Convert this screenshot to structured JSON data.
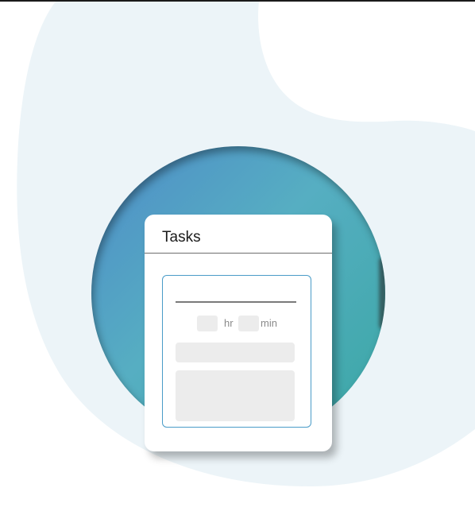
{
  "card": {
    "title": "Tasks"
  },
  "task_form": {
    "hours_value": "",
    "hours_unit": "hr",
    "minutes_value": "",
    "minutes_unit": "min",
    "title_value": "",
    "short_field_value": "",
    "notes_value": ""
  },
  "colors": {
    "blob": "#ecf4f8",
    "circle_start": "#4e8cc8",
    "circle_end": "#3aa7a4",
    "panel_border": "#4a9cc8",
    "field_fill": "#ececec"
  }
}
